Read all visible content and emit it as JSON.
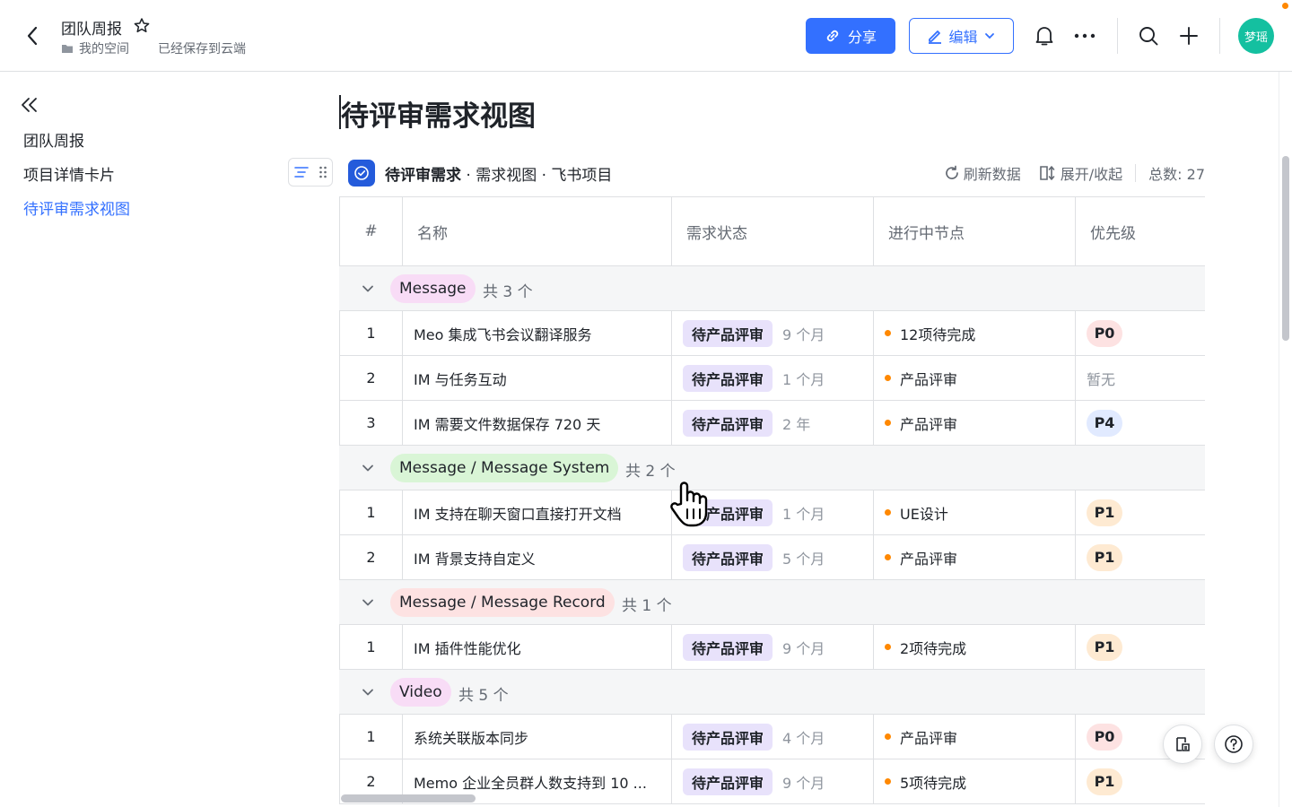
{
  "header": {
    "doc_title": "团队周报",
    "breadcrumb_space": "我的空间",
    "save_status": "已经保存到云端",
    "share_label": "分享",
    "edit_label": "编辑",
    "avatar_text": "梦瑶",
    "accent_color": "#3370ff"
  },
  "sidebar": {
    "items": [
      {
        "label": "团队周报",
        "active": false
      },
      {
        "label": "项目详情卡片",
        "active": false
      },
      {
        "label": "待评审需求视图",
        "active": true
      }
    ]
  },
  "main": {
    "page_title": "待评审需求视图",
    "block": {
      "name_bold": "待评审需求",
      "name_rest": " · 需求视图 · 飞书项目",
      "refresh_label": "刷新数据",
      "expand_label": "展开/收起",
      "total_label": "总数: 27"
    },
    "table": {
      "columns": [
        "#",
        "名称",
        "需求状态",
        "进行中节点",
        "优先级"
      ],
      "groups": [
        {
          "tag": "Message",
          "count": "共 3 个",
          "tag_bg": "#f8dcf6",
          "rows": [
            {
              "num": "1",
              "name": "Meo 集成飞书会议翻译服务",
              "status": "待产品评审",
              "age": "9 个月",
              "node": "12项待完成",
              "priority": "P0"
            },
            {
              "num": "2",
              "name": "IM 与任务互动",
              "status": "待产品评审",
              "age": "1 个月",
              "node": "产品评审",
              "priority": "暂无"
            },
            {
              "num": "3",
              "name": "IM 需要文件数据保存 720 天",
              "status": "待产品评审",
              "age": "2 年",
              "node": "产品评审",
              "priority": "P4"
            }
          ]
        },
        {
          "tag": "Message / Message System",
          "count": "共 2 个",
          "tag_bg": "#d9f5d6",
          "rows": [
            {
              "num": "1",
              "name": "IM 支持在聊天窗口直接打开文档",
              "status": "待产品评审",
              "age": "1 个月",
              "node": "UE设计",
              "priority": "P1"
            },
            {
              "num": "2",
              "name": "IM 背景支持自定义",
              "status": "待产品评审",
              "age": "5 个月",
              "node": "产品评审",
              "priority": "P1"
            }
          ]
        },
        {
          "tag": "Message / Message Record",
          "count": "共 1 个",
          "tag_bg": "#fde2e2",
          "rows": [
            {
              "num": "1",
              "name": "IM 插件性能优化",
              "status": "待产品评审",
              "age": "9 个月",
              "node": "2项待完成",
              "priority": "P1"
            }
          ]
        },
        {
          "tag": "Video",
          "count": "共 5 个",
          "tag_bg": "#f8dcf6",
          "rows": [
            {
              "num": "1",
              "name": "系统关联版本同步",
              "status": "待产品评审",
              "age": "4 个月",
              "node": "产品评审",
              "priority": "P0"
            },
            {
              "num": "2",
              "name": "Memo 企业全员群人数支持到 10 ...",
              "status": "待产品评审",
              "age": "9 个月",
              "node": "5项待完成",
              "priority": "P1"
            }
          ]
        }
      ],
      "priority_colors": {
        "P0": "#fde2e2",
        "P1": "#feead2",
        "P4": "#e1eaff"
      }
    }
  }
}
